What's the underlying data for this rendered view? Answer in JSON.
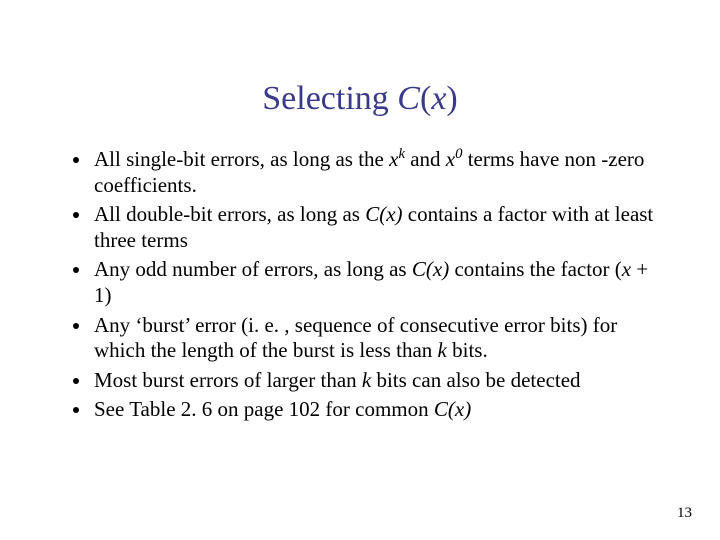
{
  "title_pre": "Selecting ",
  "title_fn_C": "C",
  "title_fn_open": "(",
  "title_fn_x": "x",
  "title_fn_close": ")",
  "b1_a": "All single-bit errors, as long as the ",
  "b1_x1": "x",
  "b1_supk": "k",
  "b1_mid": " and ",
  "b1_x2": "x",
  "b1_sup0": "0",
  "b1_b": " terms have non -zero coefficients.",
  "b2_a": "All double-bit errors, as long as ",
  "b2_C": "C",
  "b2_px": "(x)",
  "b2_b": " contains a factor with at least three terms",
  "b3_a": "Any odd number of errors, as long as ",
  "b3_C": "C",
  "b3_px": "(x)",
  "b3_b": " contains the factor (",
  "b3_x": "x",
  "b3_c": " + 1)",
  "b4_a": "Any ‘burst’ error (i. e. , sequence of consecutive error bits) for which the length of the burst is less than ",
  "b4_k": "k",
  "b4_b": " bits.",
  "b5": "Most burst errors of larger than ",
  "b5_k": "k",
  "b5_b": " bits can also be detected",
  "b6_a": "See Table 2. 6 on page 102 for common ",
  "b6_C": "C",
  "b6_px": "(x)",
  "pagenum": "13"
}
